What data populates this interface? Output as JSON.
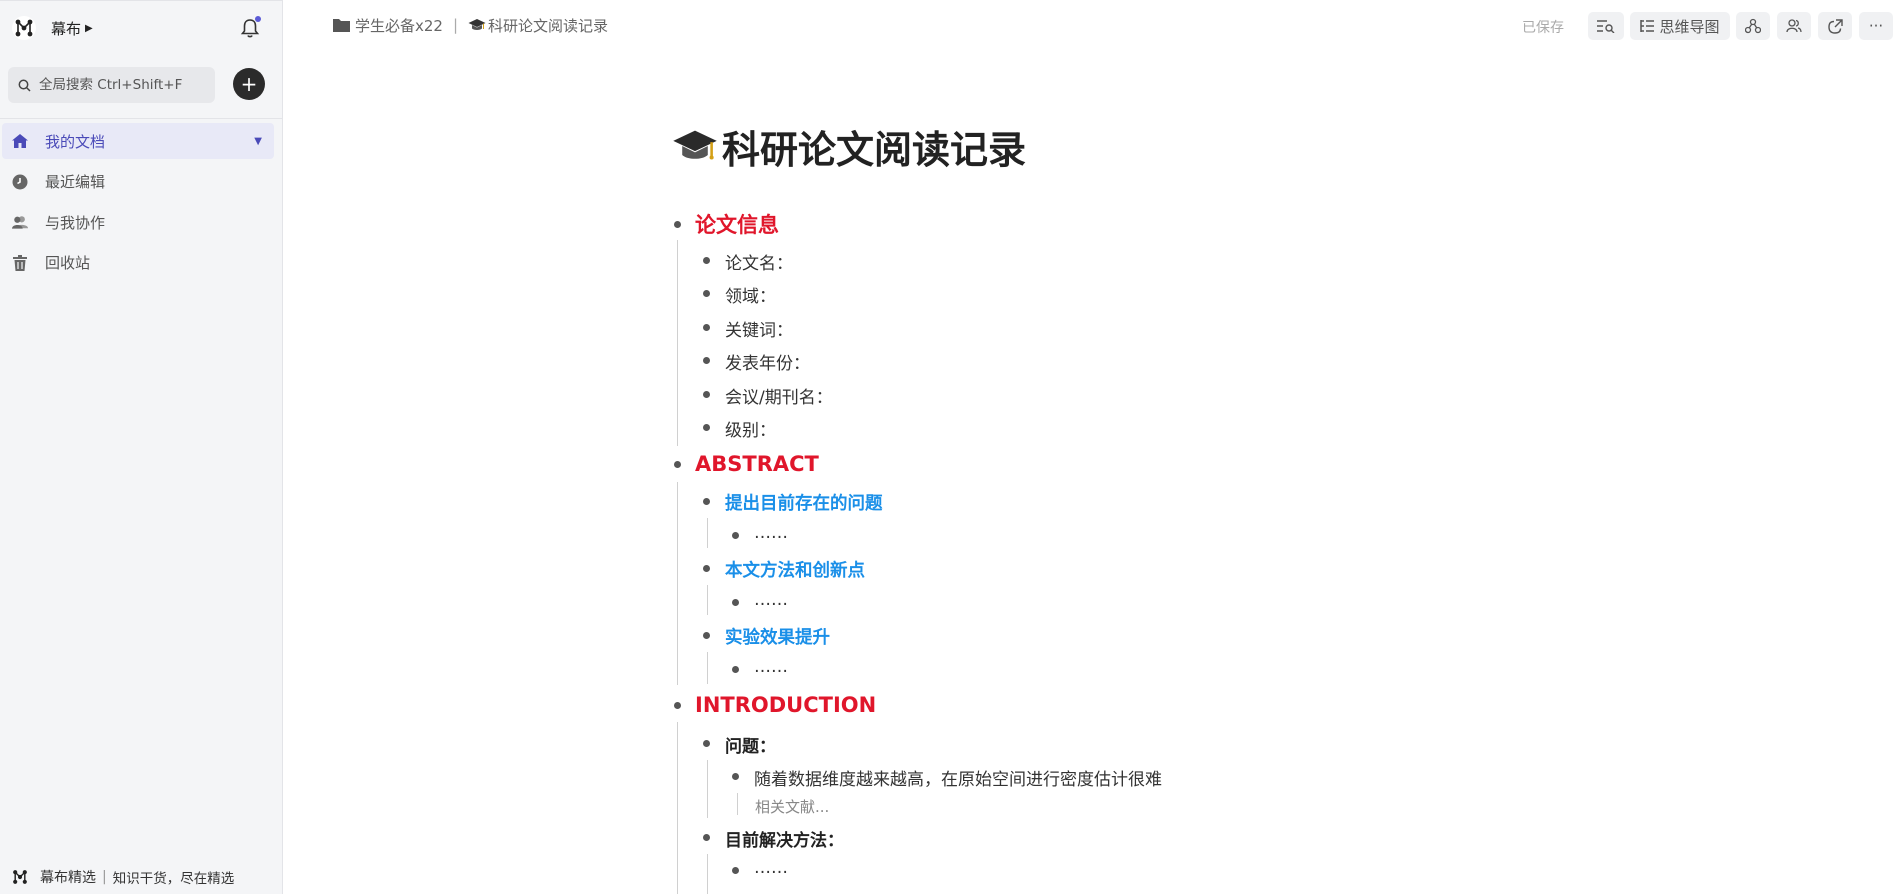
{
  "sidebar": {
    "app_name": "幕布",
    "search_placeholder": "全局搜索 Ctrl+Shift+F",
    "items": [
      {
        "label": "我的文档",
        "icon": "home-icon"
      },
      {
        "label": "最近编辑",
        "icon": "clock-icon"
      },
      {
        "label": "与我协作",
        "icon": "people-icon"
      },
      {
        "label": "回收站",
        "icon": "trash-icon"
      }
    ],
    "footer": {
      "name": "幕布精选",
      "separator": "|",
      "slogan": "知识干货，尽在精选"
    }
  },
  "topbar": {
    "breadcrumb_folder": "学生必备x22",
    "breadcrumb_separator": "|",
    "breadcrumb_doc": "科研论文阅读记录",
    "saved_status": "已保存",
    "mindmap_label": "思维导图",
    "more_label": "···"
  },
  "doc": {
    "title": "科研论文阅读记录",
    "sections": {
      "info": "论文信息",
      "info_items": [
        "论文名：",
        "领域：",
        "关键词：",
        "发表年份：",
        "会议/期刊名：",
        "级别："
      ],
      "abstract": "ABSTRACT",
      "abstract_items": [
        "提出目前存在的问题",
        "本文方法和创新点",
        "实验效果提升"
      ],
      "ellipsis": "……",
      "intro": "INTRODUCTION",
      "intro_q": "问题：",
      "intro_q_item": "随着数据维度越来越高，在原始空间进行密度估计很难",
      "intro_q_note": "相关文献...",
      "intro_m": "目前解决方法："
    }
  },
  "colors": {
    "accent": "#4a4ab8",
    "heading_red": "#e0162b",
    "heading_blue": "#1a8fe8"
  }
}
